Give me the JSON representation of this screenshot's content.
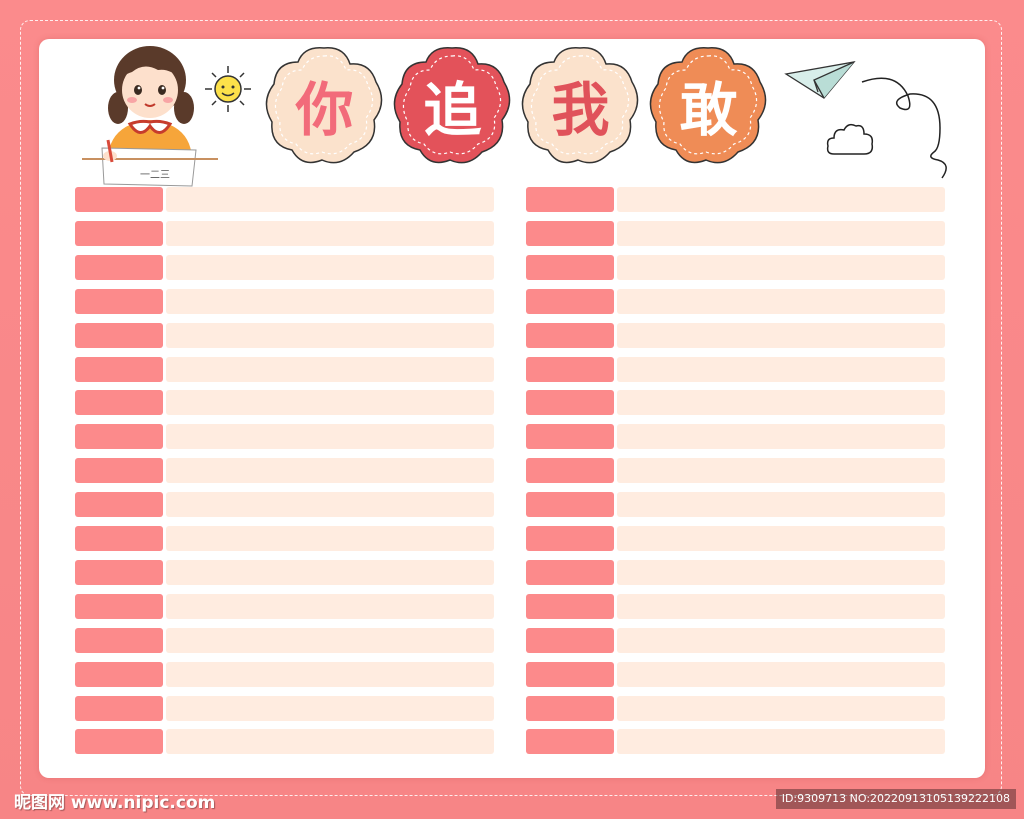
{
  "title": {
    "characters": [
      "你",
      "追",
      "我",
      "敢"
    ],
    "colors": [
      "#fbe2cc",
      "#e3525a",
      "#fbe2cc",
      "#ef8c56"
    ],
    "text_colors": [
      "#f26b7a",
      "#ffffff",
      "#e0525a",
      "#ffffff"
    ]
  },
  "illustration": {
    "paper_text": "一二三"
  },
  "list_left_count": 17,
  "list_right_count": 17,
  "watermark": {
    "site": "昵图网 www.nipic.com",
    "id": "ID:9309713 NO:20220913105139222108"
  },
  "colors": {
    "frame": "#f98a8a",
    "label": "#fc8a8b",
    "field": "#ffece0"
  }
}
